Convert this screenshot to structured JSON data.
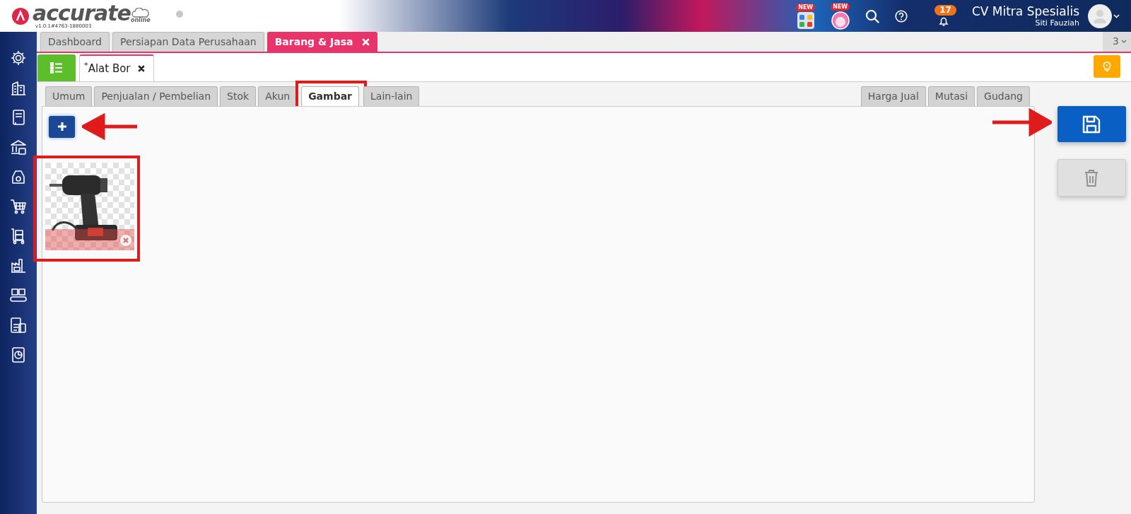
{
  "header": {
    "logo": "accurate",
    "logo_suffix": "online",
    "version": "v1.0.1#4763-1880003",
    "new_badges": [
      "NEW",
      "NEW"
    ],
    "notification_count": "17",
    "company": "CV Mitra Spesialis",
    "user": "Siti Fauziah"
  },
  "page_tabs": [
    {
      "label": "Dashboard",
      "selected": false,
      "closable": false
    },
    {
      "label": "Persiapan Data Perusahaan",
      "selected": false,
      "closable": false
    },
    {
      "label": "Barang & Jasa",
      "selected": true,
      "closable": true
    }
  ],
  "tab_count": "3",
  "document_tab": {
    "label": "$^{*}$Alat Bor",
    "closable": true
  },
  "form_tabs_left": [
    {
      "label": "Umum",
      "selected": false,
      "highlighted": false
    },
    {
      "label": "Penjualan / Pembelian",
      "selected": false,
      "highlighted": false
    },
    {
      "label": "Stok",
      "selected": false,
      "highlighted": false
    },
    {
      "label": "Akun",
      "selected": false,
      "highlighted": false
    },
    {
      "label": "Gambar",
      "selected": true,
      "highlighted": true
    },
    {
      "label": "Lain-lain",
      "selected": false,
      "highlighted": false
    }
  ],
  "form_tabs_right": [
    {
      "label": "Harga Jual",
      "selected": false
    },
    {
      "label": "Mutasi",
      "selected": false
    },
    {
      "label": "Gudang",
      "selected": false
    }
  ],
  "add_button": {
    "pointer": true
  },
  "images": [
    {
      "kind": "picture",
      "highlighted": true
    }
  ],
  "save_button": {
    "pointer": true
  },
  "delete_button": {
    "disabled": true
  }
}
